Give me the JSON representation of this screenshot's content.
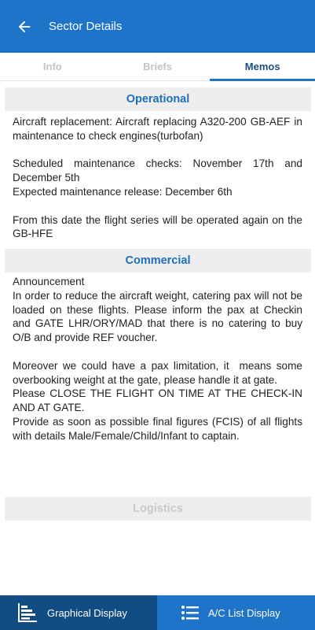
{
  "header": {
    "title": "Sector Details",
    "back_icon": "arrow-left-icon"
  },
  "tabs": [
    {
      "label": "Info",
      "active": false
    },
    {
      "label": "Briefs",
      "active": false
    },
    {
      "label": "Memos",
      "active": true
    }
  ],
  "sections": {
    "operational": {
      "title": "Operational",
      "body": "Aircraft replacement: Aircraft replacing A320-200 GB-AEF in maintenance to check engines(turbofan)\n\nScheduled maintenance checks: November 17th and December 5th\nExpected maintenance release: December 6th\n\nFrom this date the flight series will be operated again on the GB-HFE"
    },
    "commercial": {
      "title": "Commercial",
      "body": "Announcement\nIn order to reduce the aircraft weight, catering pax will not be loaded on these flights. Please inform the pax at Checkin and GATE LHR/ORY/MAD that there is no catering to buy O/B and provide REF voucher.\n\nMoreover we could have a pax limitation, it  means some overbooking weight at the gate, please handle it at gate.\nPlease CLOSE THE FLIGHT ON TIME AT THE CHECK-IN AND AT GATE.\nProvide as soon as possible final figures (FCIS) of all flights with details Male/Female/Child/Infant to captain."
    },
    "logistics": {
      "title": "Logistics"
    }
  },
  "bottom_nav": {
    "graphical": {
      "label": "Graphical Display",
      "icon": "bar-chart-icon"
    },
    "list": {
      "label": "A/C List Display",
      "icon": "list-icon"
    }
  },
  "colors": {
    "primary": "#1e74c8",
    "primary_dark": "#124c84",
    "section_title": "#1e6fb8",
    "tab_active": "#1a4f86"
  }
}
